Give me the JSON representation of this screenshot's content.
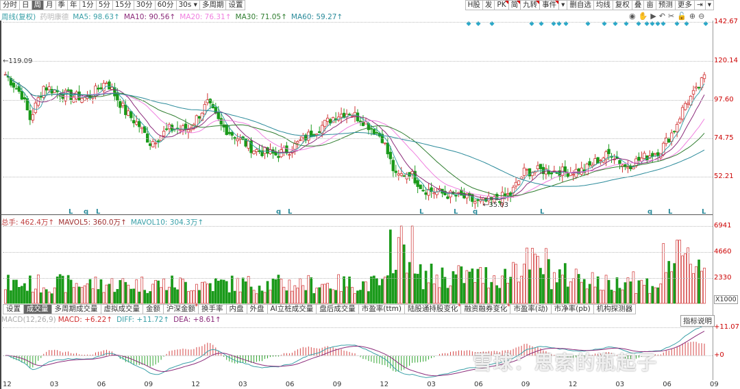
{
  "toolbar_left": [
    {
      "label": "分时"
    },
    {
      "label": "日"
    },
    {
      "label": "周",
      "active": true
    },
    {
      "label": "月"
    },
    {
      "label": "季"
    },
    {
      "label": "年"
    },
    {
      "label": "1分"
    },
    {
      "label": "5分"
    },
    {
      "label": "15分"
    },
    {
      "label": "30分"
    },
    {
      "label": "60分"
    },
    {
      "label": "30s ▾"
    },
    {
      "label": "多周期"
    },
    {
      "label": "设置"
    }
  ],
  "toolbar_right": [
    {
      "label": "H股"
    },
    {
      "label": "发"
    },
    {
      "label": "PK",
      "flag": true
    },
    {
      "label": "简",
      "flag": true
    },
    {
      "label": "九转",
      "flag": true
    },
    {
      "label": "事件",
      "flag": true
    },
    {
      "label": "▾"
    },
    {
      "label": "删自选"
    },
    {
      "label": "均线"
    },
    {
      "label": "复权"
    },
    {
      "label": "叠"
    },
    {
      "label": "亩"
    },
    {
      "label": "预测"
    },
    {
      "label": "更多"
    },
    {
      "label": "⇥"
    },
    {
      "label": "▾"
    }
  ],
  "chart_icons": [
    "eye-icon",
    "hand-icon",
    "play-icon",
    "undo-icon",
    "scissors-icon",
    "lock-icon",
    "zoom-in-icon",
    "zoom-out-icon"
  ],
  "price_legend": {
    "period": "周线(复权)",
    "name": "药明康德",
    "ma5": "MA5: 98.63↑",
    "ma10": "MA10: 90.56↑",
    "ma20": "MA20: 76.31↑",
    "ma30": "MA30: 71.05↑",
    "ma60": "MA60: 59.27↑"
  },
  "colors": {
    "up": "#d03030",
    "down": "#1a9a1a",
    "ma5": "#3aa0a8",
    "ma10": "#8b2a7a",
    "ma20": "#f080e0",
    "ma30": "#2e7d2e",
    "ma60": "#2a8a9a"
  },
  "price_axis": [
    "142.67",
    "120.14",
    "97.60",
    "74.75",
    "52.21"
  ],
  "price_range": [
    30,
    142.67
  ],
  "high_marker": "119.09",
  "low_marker": "35.03",
  "event_markers": [
    "L",
    "q",
    "L",
    "q",
    "L",
    "L",
    "L",
    "q",
    "L",
    "q",
    "L",
    "L"
  ],
  "price_keypoints": [
    [
      0,
      112
    ],
    [
      6,
      100
    ],
    [
      9,
      86
    ],
    [
      14,
      105
    ],
    [
      22,
      100
    ],
    [
      30,
      98
    ],
    [
      37,
      108
    ],
    [
      44,
      90
    ],
    [
      49,
      82
    ],
    [
      53,
      72
    ],
    [
      60,
      80
    ],
    [
      67,
      80
    ],
    [
      74,
      95
    ],
    [
      79,
      82
    ],
    [
      84,
      76
    ],
    [
      91,
      68
    ],
    [
      99,
      65
    ],
    [
      104,
      68
    ],
    [
      109,
      74
    ],
    [
      116,
      82
    ],
    [
      121,
      88
    ],
    [
      126,
      90
    ],
    [
      131,
      85
    ],
    [
      138,
      75
    ],
    [
      143,
      52
    ],
    [
      148,
      55
    ],
    [
      153,
      45
    ],
    [
      161,
      42
    ],
    [
      168,
      40
    ],
    [
      173,
      37
    ],
    [
      178,
      38
    ],
    [
      185,
      42
    ],
    [
      190,
      55
    ],
    [
      197,
      56
    ],
    [
      205,
      55
    ],
    [
      212,
      56
    ],
    [
      217,
      62
    ],
    [
      222,
      66
    ],
    [
      227,
      58
    ],
    [
      232,
      62
    ],
    [
      240,
      68
    ],
    [
      245,
      80
    ],
    [
      249,
      95
    ],
    [
      253,
      102
    ],
    [
      256,
      110
    ]
  ],
  "volume_legend": {
    "total": "总手: 462.4万↑",
    "mavol5": "MAVOL5: 360.0万↑",
    "mavol10": "MAVOL10: 304.3万↑"
  },
  "volume_axis": [
    "6941",
    "4660",
    "2330"
  ],
  "volume_unit": "X1000",
  "tabs": [
    {
      "label": "设置"
    },
    {
      "label": "成交量",
      "active": true
    },
    {
      "label": "多周期成交量"
    },
    {
      "label": "虚拟成交量"
    },
    {
      "label": "金额"
    },
    {
      "label": "沪深金额",
      "dot": true
    },
    {
      "label": "换手率"
    },
    {
      "label": "内盘"
    },
    {
      "label": "外盘"
    },
    {
      "label": "AI立桩成交量"
    },
    {
      "label": "盘后成交量"
    },
    {
      "label": "市盈率(ttm)"
    },
    {
      "label": "陆股通持股变化",
      "dot": true
    },
    {
      "label": "融资融券变化",
      "dot": true
    },
    {
      "label": "市盈率(动)"
    },
    {
      "label": "市净率(pb)"
    },
    {
      "label": "机构探测器"
    }
  ],
  "indicator_help": "指标说明",
  "macd_legend": {
    "params": "MACD(12,26,9)",
    "macd": "MACD: +6.22↑",
    "diff": "DIFF: +11.72↑",
    "dea": "DEA: +8.61↑"
  },
  "macd_axis": [
    "+11.07",
    "+0"
  ],
  "x_labels": [
    "12",
    "03",
    "06",
    "09",
    "12",
    "03",
    "06",
    "09",
    "12",
    "03",
    "06",
    "09",
    "12",
    "03",
    "06",
    "09"
  ],
  "watermark": "雪球：思索的瓶起子"
}
